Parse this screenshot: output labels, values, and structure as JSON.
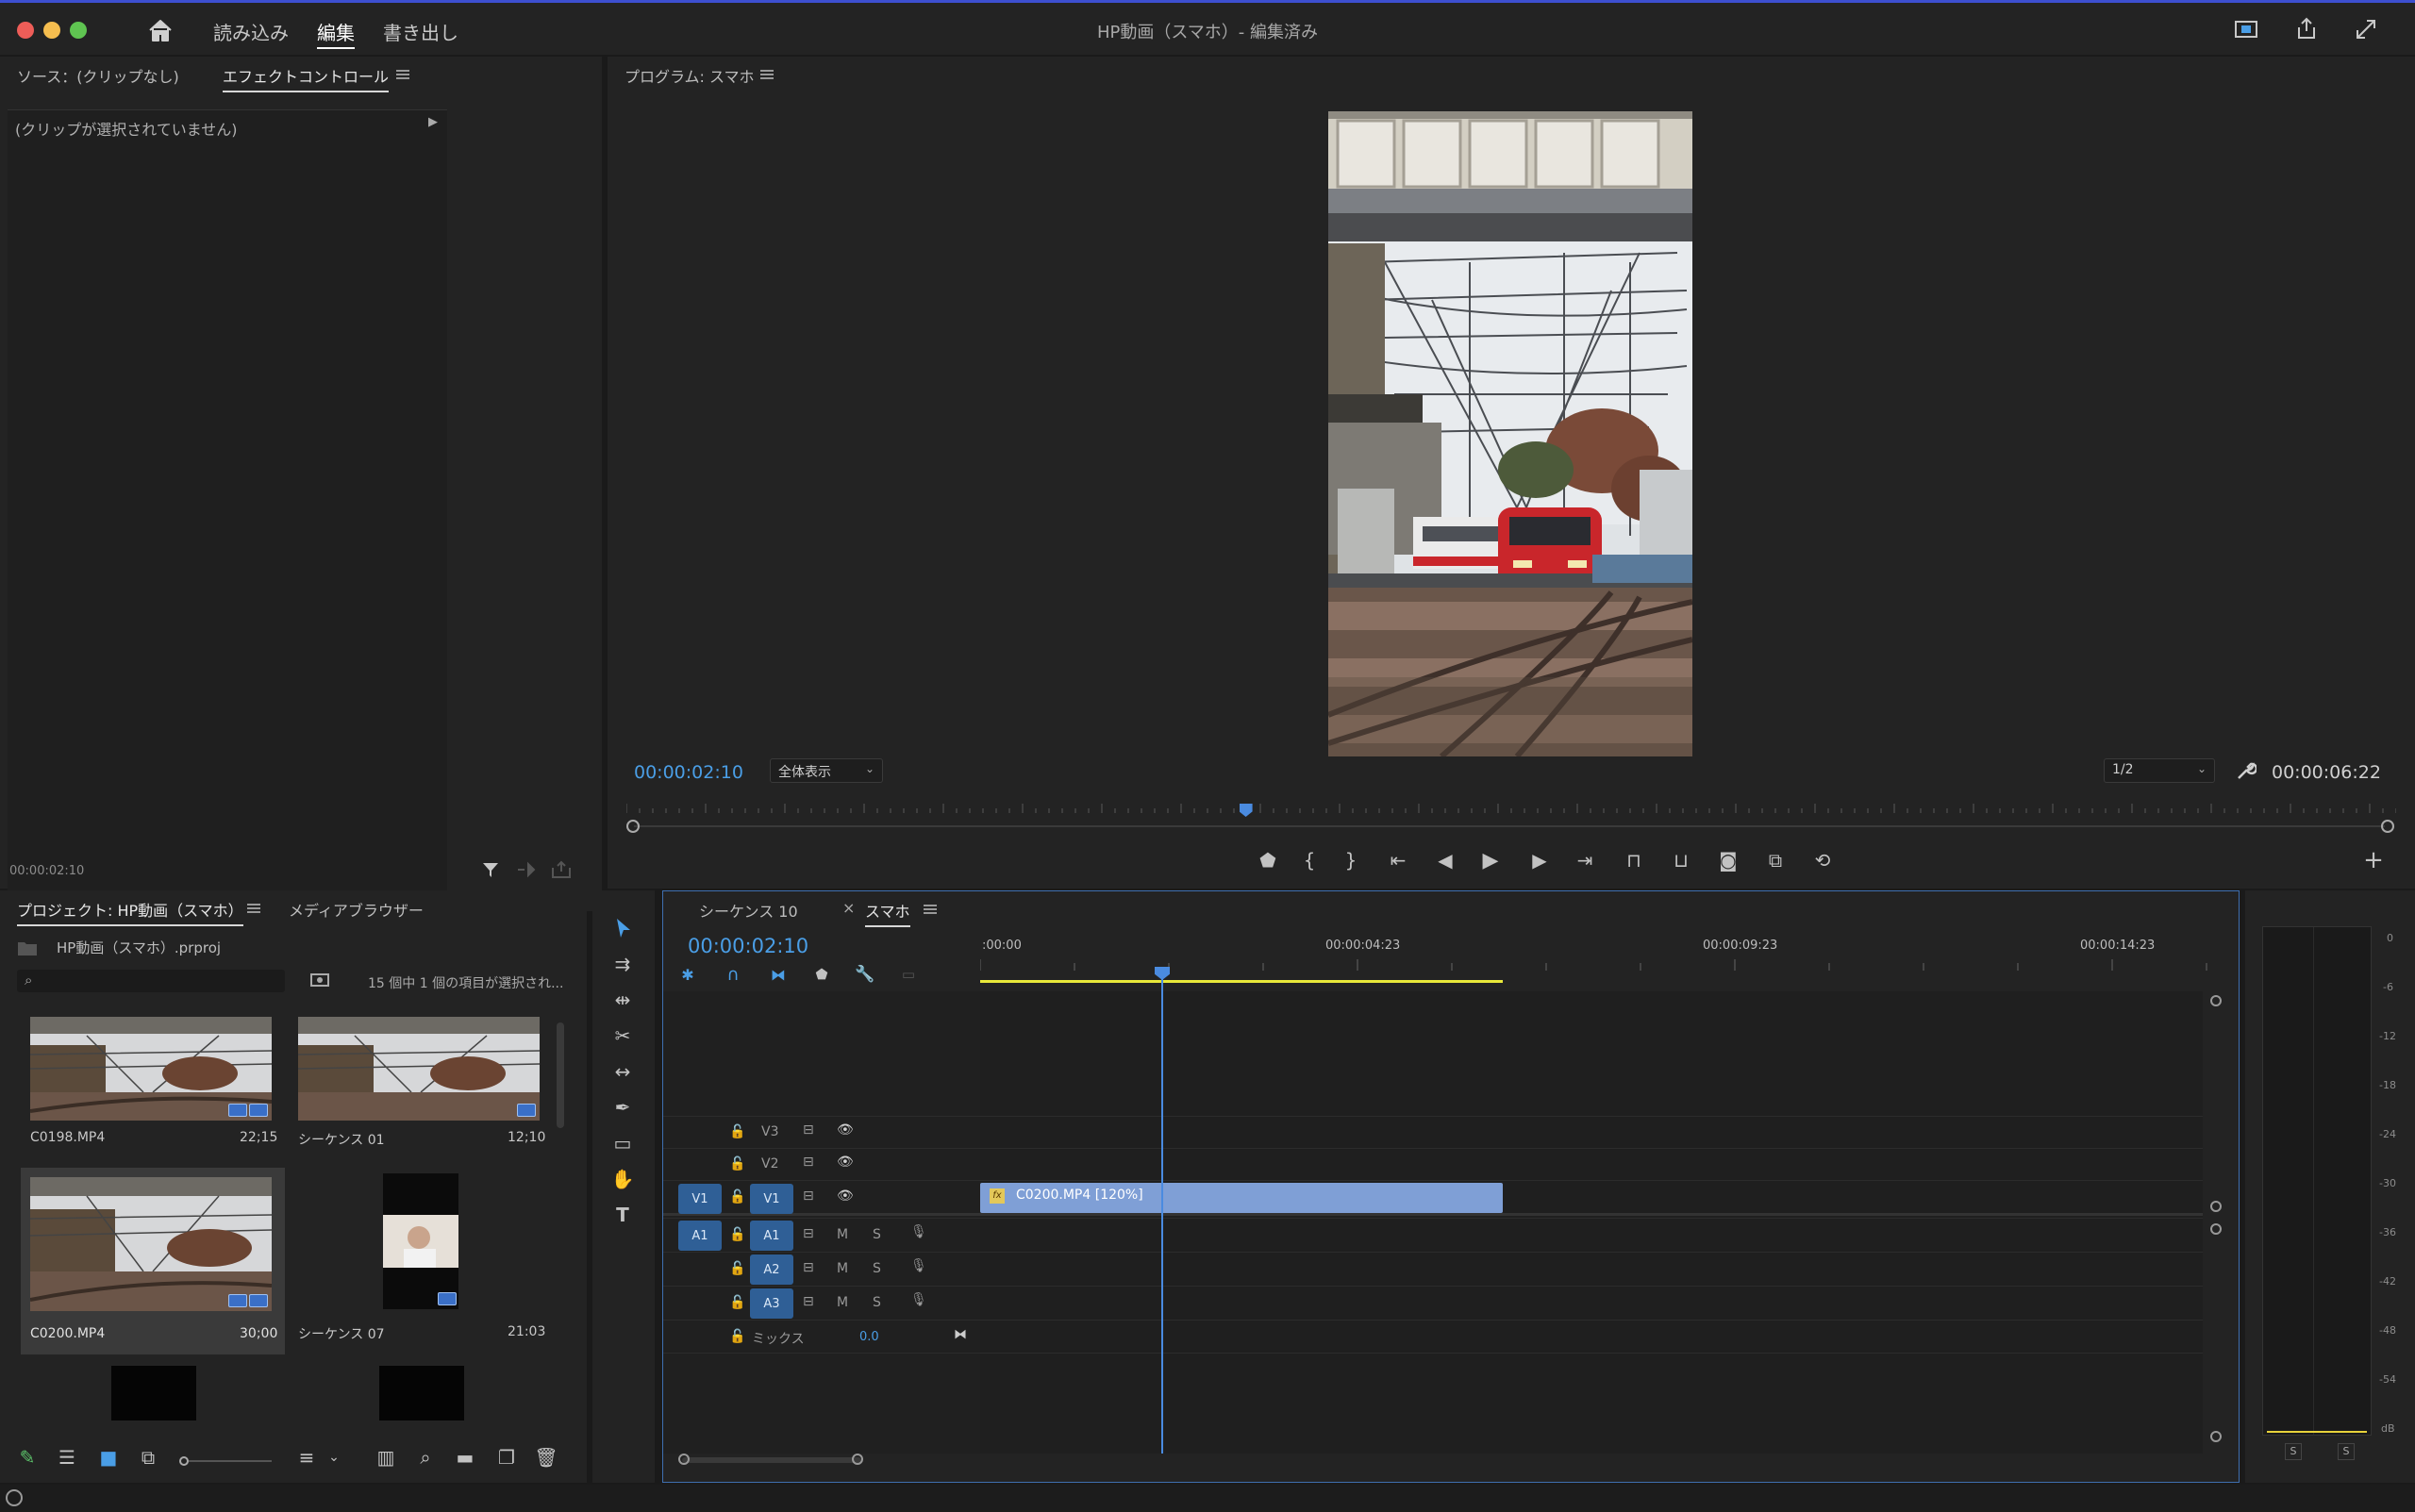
{
  "window": {
    "title": "HP動画（スマホ）- 編集済み"
  },
  "nav": {
    "import": "読み込み",
    "edit": "編集",
    "export": "書き出し"
  },
  "source_panel": {
    "tab_source": "ソース：(クリップなし)",
    "tab_effect_controls": "エフェクトコントロール",
    "no_clip": "(クリップが選択されていません)",
    "timecode": "00:00:02:10"
  },
  "program": {
    "tab": "プログラム: スマホ",
    "timecode_current": "00:00:02:10",
    "zoom": "全体表示",
    "resolution": "1/2",
    "timecode_duration": "00:00:06:22",
    "playhead_fraction": 0.35
  },
  "project": {
    "tab_project": "プロジェクト: HP動画（スマホ）",
    "tab_media_browser": "メディアブラウザー",
    "file": "HP動画（スマホ）.prproj",
    "status": "15 個中 1 個の項目が選択され...",
    "items": [
      {
        "name": "C0198.MP4",
        "duration": "22;15"
      },
      {
        "name": "シーケンス 01",
        "duration": "12;10"
      },
      {
        "name": "C0200.MP4",
        "duration": "30;00"
      },
      {
        "name": "シーケンス 07",
        "duration": "21:03"
      }
    ]
  },
  "timeline": {
    "tab_inactive": "シーケンス 10",
    "tab_active": "スマホ",
    "close_glyph": "×",
    "timecode": "00:00:02:10",
    "ruler": [
      ":00:00",
      "00:00:04:23",
      "00:00:09:23",
      "00:00:14:23"
    ],
    "video_tracks": [
      "V3",
      "V2",
      "V1"
    ],
    "audio_tracks": [
      "A1",
      "A2",
      "A3"
    ],
    "src_v": "V1",
    "src_a": "A1",
    "mute": "M",
    "solo": "S",
    "mix_label": "ミックス",
    "mix_value": "0.0",
    "clip_label": "C0200.MP4 [120%]",
    "fx": "fx"
  },
  "meter": {
    "ticks": [
      "0",
      "-6",
      "-12",
      "-18",
      "-24",
      "-30",
      "-36",
      "-42",
      "-48",
      "-54",
      "dB"
    ],
    "solo_left": "S",
    "solo_right": "S"
  },
  "colors": {
    "accent_blue": "#4a9ee6",
    "clip": "#7f9fd6",
    "track_select": "#2f5f96",
    "work_area": "#e8e83a",
    "title_bar_edge": "#3d4fd0"
  }
}
